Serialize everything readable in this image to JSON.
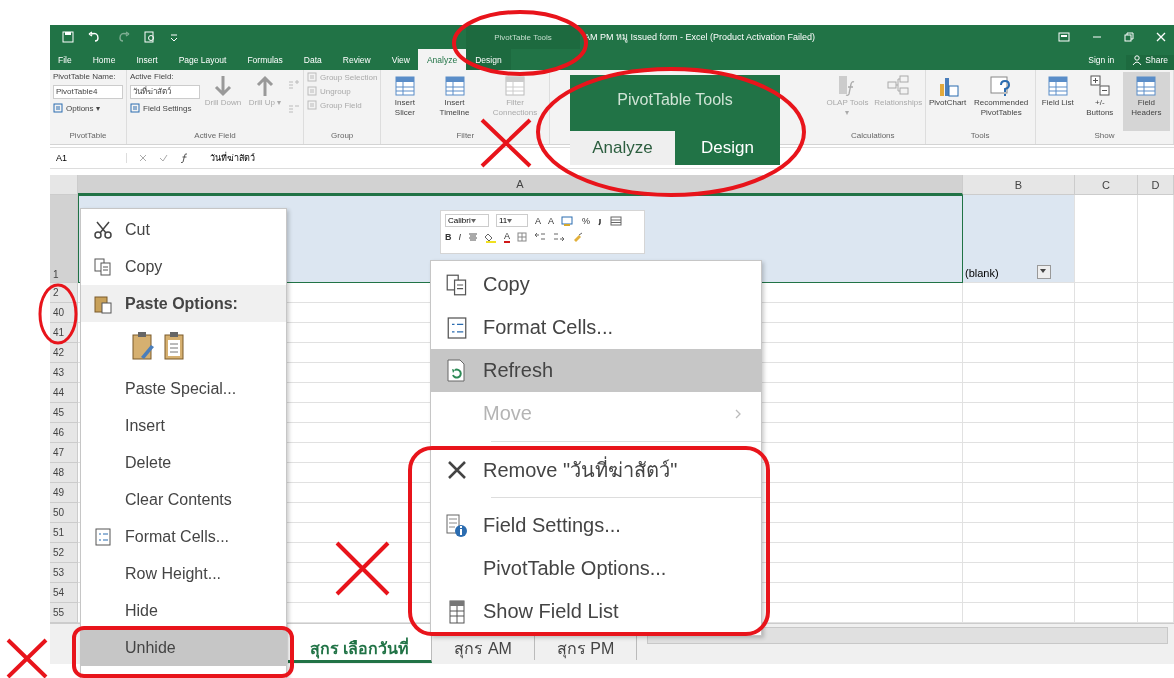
{
  "window": {
    "title": "AM PM หมู Issued form - Excel (Product Activation Failed)",
    "context_group": "PivotTable Tools",
    "sign_in": "Sign in",
    "share": "Share"
  },
  "ribbon_tabs": [
    {
      "label": "File",
      "selected": false,
      "kind": "normal"
    },
    {
      "label": "Home",
      "selected": false,
      "kind": "normal"
    },
    {
      "label": "Insert",
      "selected": false,
      "kind": "normal"
    },
    {
      "label": "Page Layout",
      "selected": false,
      "kind": "normal"
    },
    {
      "label": "Formulas",
      "selected": false,
      "kind": "normal"
    },
    {
      "label": "Data",
      "selected": false,
      "kind": "normal"
    },
    {
      "label": "Review",
      "selected": false,
      "kind": "normal"
    },
    {
      "label": "View",
      "selected": false,
      "kind": "normal"
    },
    {
      "label": "Analyze",
      "selected": true,
      "kind": "context"
    },
    {
      "label": "Design",
      "selected": false,
      "kind": "context"
    }
  ],
  "ribbon_groups": [
    {
      "label": "PivotTable",
      "columns": [
        {
          "kind": "stack",
          "items": [
            {
              "kind": "caption",
              "text": "PivotTable Name:"
            },
            {
              "kind": "field",
              "value": "PivotTable4"
            },
            {
              "kind": "small",
              "label": "Options ▾",
              "disabled": false
            }
          ]
        }
      ]
    },
    {
      "label": "Active Field",
      "columns": [
        {
          "kind": "stack",
          "items": [
            {
              "kind": "caption",
              "text": "Active Field:"
            },
            {
              "kind": "field",
              "value": "วันที่ฆ่าสัตว์"
            },
            {
              "kind": "small",
              "label": "Field Settings",
              "disabled": false
            }
          ]
        },
        {
          "kind": "large",
          "label": "Drill Down",
          "disabled": true,
          "selected": false
        },
        {
          "kind": "large",
          "label": "Drill Up ▾",
          "disabled": true,
          "selected": false
        },
        {
          "kind": "icon_pair"
        }
      ]
    },
    {
      "label": "Group",
      "columns": [
        {
          "kind": "stack",
          "items": [
            {
              "kind": "small",
              "label": "Group Selection",
              "disabled": true
            },
            {
              "kind": "small",
              "label": "Ungroup",
              "disabled": true
            },
            {
              "kind": "small",
              "label": "Group Field",
              "disabled": true
            }
          ]
        }
      ]
    },
    {
      "label": "Filter",
      "columns": [
        {
          "kind": "large",
          "label": "Insert Slicer",
          "disabled": false,
          "selected": false
        },
        {
          "kind": "large",
          "label": "Insert Timeline",
          "disabled": false,
          "selected": false
        },
        {
          "kind": "large",
          "label": "Filter Connections",
          "disabled": true,
          "selected": false
        }
      ]
    },
    {
      "label": "Calculations",
      "columns": [
        {
          "kind": "large",
          "label": "OLAP Tools ▾",
          "disabled": true,
          "selected": false
        },
        {
          "kind": "large",
          "label": "Relationships",
          "disabled": true,
          "selected": false
        }
      ]
    },
    {
      "label": "Tools",
      "columns": [
        {
          "kind": "large",
          "label": "PivotChart",
          "disabled": false,
          "selected": false
        },
        {
          "kind": "large",
          "label": "Recommended PivotTables",
          "disabled": false,
          "selected": false
        }
      ]
    },
    {
      "label": "Show",
      "columns": [
        {
          "kind": "large",
          "label": "Field List",
          "disabled": false,
          "selected": false
        },
        {
          "kind": "large",
          "label": "+/- Buttons",
          "disabled": false,
          "selected": false
        },
        {
          "kind": "large",
          "label": "Field Headers",
          "disabled": false,
          "selected": true
        }
      ]
    }
  ],
  "callout": {
    "title": "PivotTable Tools",
    "tabs": [
      {
        "label": "Analyze",
        "selected": true
      },
      {
        "label": "Design",
        "selected": false
      }
    ]
  },
  "formula_bar": {
    "name_box": "A1",
    "content": "วันที่ฆ่าสัตว์"
  },
  "columns": [
    {
      "label": "A",
      "selected": true
    },
    {
      "label": "B",
      "selected": false
    },
    {
      "label": "C",
      "selected": false
    },
    {
      "label": "D",
      "selected": false
    }
  ],
  "rows": [
    {
      "header": "1",
      "selected": true,
      "cell_b": "(blank)",
      "filter_button": true
    },
    {
      "header": "2",
      "selected": false,
      "filter_button": false
    },
    {
      "header": "40",
      "selected": false,
      "filter_button": false
    },
    {
      "header": "41",
      "selected": false,
      "filter_button": false
    },
    {
      "header": "42",
      "selected": false,
      "filter_button": false
    },
    {
      "header": "43",
      "selected": false,
      "filter_button": false
    },
    {
      "header": "44",
      "selected": false,
      "filter_button": false
    },
    {
      "header": "45",
      "selected": false,
      "filter_button": false
    },
    {
      "header": "46",
      "selected": false,
      "filter_button": false
    },
    {
      "header": "47",
      "selected": false,
      "filter_button": false
    },
    {
      "header": "48",
      "selected": false,
      "filter_button": false
    },
    {
      "header": "49",
      "selected": false,
      "filter_button": false
    },
    {
      "header": "50",
      "selected": false,
      "filter_button": false
    },
    {
      "header": "51",
      "selected": false,
      "filter_button": false
    },
    {
      "header": "52",
      "selected": false,
      "filter_button": false
    },
    {
      "header": "53",
      "selected": false,
      "filter_button": false
    },
    {
      "header": "54",
      "selected": false,
      "filter_button": false
    },
    {
      "header": "55",
      "selected": false,
      "filter_button": false
    }
  ],
  "sheet_tabs": [
    {
      "label": "สุกร เลือกวันที่",
      "selected": true
    },
    {
      "label": "สุกร AM",
      "selected": false
    },
    {
      "label": "สุกร PM",
      "selected": false
    }
  ],
  "mini_toolbar": {
    "font": "Calibri",
    "size": "11",
    "row1": [
      {
        "kind": "grow",
        "glyph": "A"
      },
      {
        "kind": "shrink",
        "glyph": "A"
      },
      {
        "kind": "format"
      },
      {
        "kind": "percent",
        "glyph": "%"
      },
      {
        "kind": "comma"
      },
      {
        "kind": "table"
      }
    ],
    "row2": [
      {
        "kind": "bold",
        "glyph": "B"
      },
      {
        "kind": "italic",
        "glyph": "I"
      },
      {
        "kind": "align"
      },
      {
        "kind": "fill"
      },
      {
        "kind": "font_color",
        "glyph": "A"
      },
      {
        "kind": "borders"
      },
      {
        "kind": "inc_decimal"
      },
      {
        "kind": "dec_decimal"
      },
      {
        "kind": "painter"
      }
    ]
  },
  "cell_menu": [
    {
      "kind": "command",
      "label": "Cut",
      "selected": false,
      "disabled": false,
      "submenu": false
    },
    {
      "kind": "command",
      "label": "Copy",
      "selected": false,
      "disabled": false,
      "submenu": false
    },
    {
      "kind": "header",
      "label": "Paste Options:"
    },
    {
      "kind": "paste_icons"
    },
    {
      "kind": "command",
      "label": "Paste Special...",
      "selected": false,
      "disabled": false,
      "submenu": false
    },
    {
      "kind": "command",
      "label": "Insert",
      "selected": false,
      "disabled": false,
      "submenu": false
    },
    {
      "kind": "command",
      "label": "Delete",
      "selected": false,
      "disabled": false,
      "submenu": false
    },
    {
      "kind": "command",
      "label": "Clear Contents",
      "selected": false,
      "disabled": false,
      "submenu": false
    },
    {
      "kind": "command",
      "label": "Format Cells...",
      "selected": false,
      "disabled": false,
      "submenu": false
    },
    {
      "kind": "command",
      "label": "Row Height...",
      "selected": false,
      "disabled": false,
      "submenu": false
    },
    {
      "kind": "command",
      "label": "Hide",
      "selected": false,
      "disabled": false,
      "submenu": false
    },
    {
      "kind": "command",
      "label": "Unhide",
      "selected": true,
      "disabled": false,
      "submenu": false
    }
  ],
  "pivot_menu": [
    {
      "kind": "command",
      "label": "Copy",
      "selected": false,
      "disabled": false,
      "submenu": false
    },
    {
      "kind": "command",
      "label": "Format Cells...",
      "selected": false,
      "disabled": false,
      "submenu": false
    },
    {
      "kind": "command",
      "label": "Refresh",
      "selected": true,
      "disabled": false,
      "submenu": false
    },
    {
      "kind": "command",
      "label": "Move",
      "selected": false,
      "disabled": true,
      "submenu": true
    },
    {
      "kind": "separator"
    },
    {
      "kind": "command",
      "label": "Remove \"วันที่ฆ่าสัตว์\"",
      "selected": false,
      "disabled": false,
      "submenu": false
    },
    {
      "kind": "separator"
    },
    {
      "kind": "command",
      "label": "Field Settings...",
      "selected": false,
      "disabled": false,
      "submenu": false
    },
    {
      "kind": "command",
      "label": "PivotTable Options...",
      "selected": false,
      "disabled": false,
      "submenu": false
    },
    {
      "kind": "command",
      "label": "Show Field List",
      "selected": false,
      "disabled": false,
      "submenu": false
    }
  ]
}
